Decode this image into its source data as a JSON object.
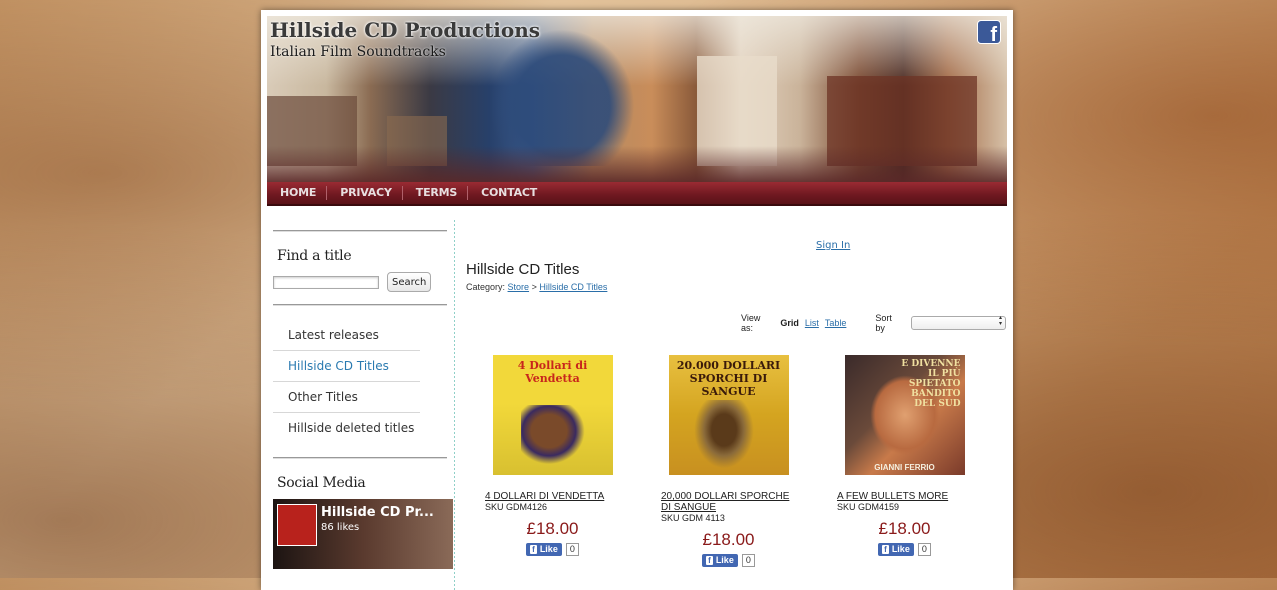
{
  "header": {
    "site_title": "Hillside CD Productions",
    "site_subtitle": "Italian Film Soundtracks",
    "facebook_icon": "f"
  },
  "nav": [
    "HOME",
    "PRIVACY",
    "TERMS",
    "CONTACT"
  ],
  "sidebar": {
    "find_heading": "Find a title",
    "search_button": "Search",
    "menu": [
      "Latest releases",
      "Hillside CD Titles",
      "Other Titles",
      "Hillside deleted titles"
    ],
    "active_index": 1,
    "social_heading": "Social Media",
    "fb_page_name": "Hillside CD Pr...",
    "fb_likes": "86 likes"
  },
  "main": {
    "signin": "Sign In",
    "title": "Hillside CD Titles",
    "category_label": "Category:",
    "crumb_store": "Store",
    "crumb_sep": ">",
    "crumb_current": "Hillside CD Titles",
    "view_as": "View as:",
    "view_grid": "Grid",
    "view_list": "List",
    "view_table": "Table",
    "sort_by": "Sort by"
  },
  "products": [
    {
      "name": "4 DOLLARI DI VENDETTA",
      "sku": "SKU GDM4126",
      "price": "£18.00",
      "like": "Like",
      "count": "0",
      "cover_text": "4 Dollari di Vendetta"
    },
    {
      "name": "20,000 DOLLARI SPORCHE DI SANGUE",
      "sku": "SKU GDM 4113",
      "price": "£18.00",
      "like": "Like",
      "count": "0",
      "cover_text": "20.000 DOLLARI SPORCHI DI SANGUE"
    },
    {
      "name": "A FEW BULLETS MORE",
      "sku": "SKU GDM4159",
      "price": "£18.00",
      "like": "Like",
      "count": "0",
      "cover_text": "E DIVENNE IL PIÙ SPIETATO BANDITO DEL SUD",
      "cover_composer": "GIANNI FERRIO"
    }
  ]
}
